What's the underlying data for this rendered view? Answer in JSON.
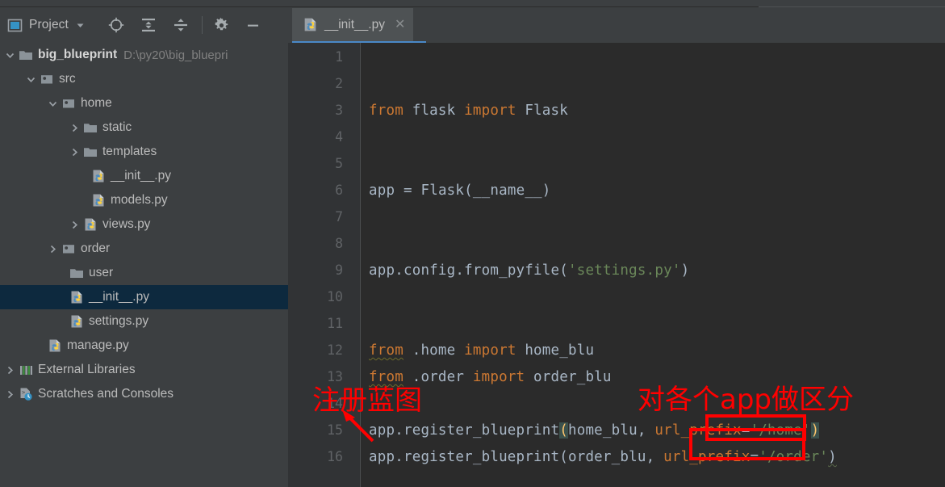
{
  "window": {
    "theme_bg": "#3c3f41",
    "editor_bg": "#2b2b2b",
    "accent": "#4a88c7",
    "annotation_color": "#ff0000"
  },
  "toolbar": {
    "project_label": "Project",
    "dropdown_icon": "chevron-down-icon",
    "icons": [
      {
        "name": "locate-target-icon",
        "title": "Select Opened File"
      },
      {
        "name": "expand-all-icon",
        "title": "Expand All"
      },
      {
        "name": "collapse-all-icon",
        "title": "Collapse All"
      },
      {
        "name": "gear-icon",
        "title": "Settings"
      },
      {
        "name": "minimize-icon",
        "title": "Hide"
      }
    ]
  },
  "tree": {
    "items": [
      {
        "label": "big_blueprint",
        "path": "D:\\py20\\big_bluepri",
        "icon": "folder-icon",
        "arrow": "expanded",
        "indent": 0,
        "bold": true,
        "selected": false
      },
      {
        "label": "src",
        "path": "",
        "icon": "source-folder-icon",
        "arrow": "expanded",
        "indent": 1,
        "bold": false,
        "selected": false
      },
      {
        "label": "home",
        "path": "",
        "icon": "source-folder-icon",
        "arrow": "expanded",
        "indent": 2,
        "bold": false,
        "selected": false
      },
      {
        "label": "static",
        "path": "",
        "icon": "folder-icon",
        "arrow": "collapsed",
        "indent": 3,
        "bold": false,
        "selected": false
      },
      {
        "label": "templates",
        "path": "",
        "icon": "folder-icon",
        "arrow": "collapsed",
        "indent": 3,
        "bold": false,
        "selected": false
      },
      {
        "label": "__init__.py",
        "path": "",
        "icon": "python-file-icon",
        "arrow": "none",
        "indent": 4,
        "bold": false,
        "selected": false
      },
      {
        "label": "models.py",
        "path": "",
        "icon": "python-file-icon",
        "arrow": "none",
        "indent": 4,
        "bold": false,
        "selected": false
      },
      {
        "label": "views.py",
        "path": "",
        "icon": "python-file-icon",
        "arrow": "collapsed",
        "indent": 3,
        "bold": false,
        "selected": false
      },
      {
        "label": "order",
        "path": "",
        "icon": "source-folder-icon",
        "arrow": "collapsed",
        "indent": 2,
        "bold": false,
        "selected": false
      },
      {
        "label": "user",
        "path": "",
        "icon": "folder-icon",
        "arrow": "none",
        "indent": 3,
        "bold": false,
        "selected": false
      },
      {
        "label": "__init__.py",
        "path": "",
        "icon": "python-file-icon",
        "arrow": "none",
        "indent": 3,
        "bold": false,
        "selected": true
      },
      {
        "label": "settings.py",
        "path": "",
        "icon": "python-file-icon",
        "arrow": "none",
        "indent": 3,
        "bold": false,
        "selected": false
      },
      {
        "label": "manage.py",
        "path": "",
        "icon": "python-file-icon",
        "arrow": "none",
        "indent": 2,
        "bold": false,
        "selected": false
      },
      {
        "label": "External Libraries",
        "path": "",
        "icon": "libraries-icon",
        "arrow": "collapsed",
        "indent": 0,
        "bold": false,
        "selected": false
      },
      {
        "label": "Scratches and Consoles",
        "path": "",
        "icon": "scratches-icon",
        "arrow": "collapsed",
        "indent": 0,
        "bold": false,
        "selected": false
      }
    ]
  },
  "editor": {
    "tab": {
      "label": "__init__.py",
      "icon": "python-file-icon",
      "close_icon": "close-icon",
      "active": true
    },
    "gutter_numbers": [
      "1",
      "2",
      "3",
      "4",
      "5",
      "6",
      "7",
      "8",
      "9",
      "10",
      "11",
      "12",
      "13",
      "14",
      "15",
      "16"
    ],
    "lines": [
      {
        "num": "1",
        "text": ""
      },
      {
        "num": "2",
        "text": ""
      },
      {
        "num": "3",
        "text": "from flask import Flask"
      },
      {
        "num": "4",
        "text": ""
      },
      {
        "num": "5",
        "text": ""
      },
      {
        "num": "6",
        "text": "app = Flask(__name__)"
      },
      {
        "num": "7",
        "text": ""
      },
      {
        "num": "8",
        "text": ""
      },
      {
        "num": "9",
        "text": "app.config.from_pyfile('settings.py')"
      },
      {
        "num": "10",
        "text": ""
      },
      {
        "num": "11",
        "text": ""
      },
      {
        "num": "12",
        "text": "from .home import home_blu"
      },
      {
        "num": "13",
        "text": "from .order import order_blu"
      },
      {
        "num": "14",
        "text": ""
      },
      {
        "num": "15",
        "text": "app.register_blueprint(home_blu, url_prefix='/home')"
      },
      {
        "num": "16",
        "text": "app.register_blueprint(order_blu, url_prefix='/order')"
      }
    ]
  },
  "annotations": {
    "note_register_blueprint": "注册蓝图",
    "note_distinguish_apps": "对各个app做区分",
    "arrow_icon": "red-arrow-icon",
    "box_1_target": "url_prefix='/home'",
    "box_2_target": "url_prefix='/order'"
  }
}
